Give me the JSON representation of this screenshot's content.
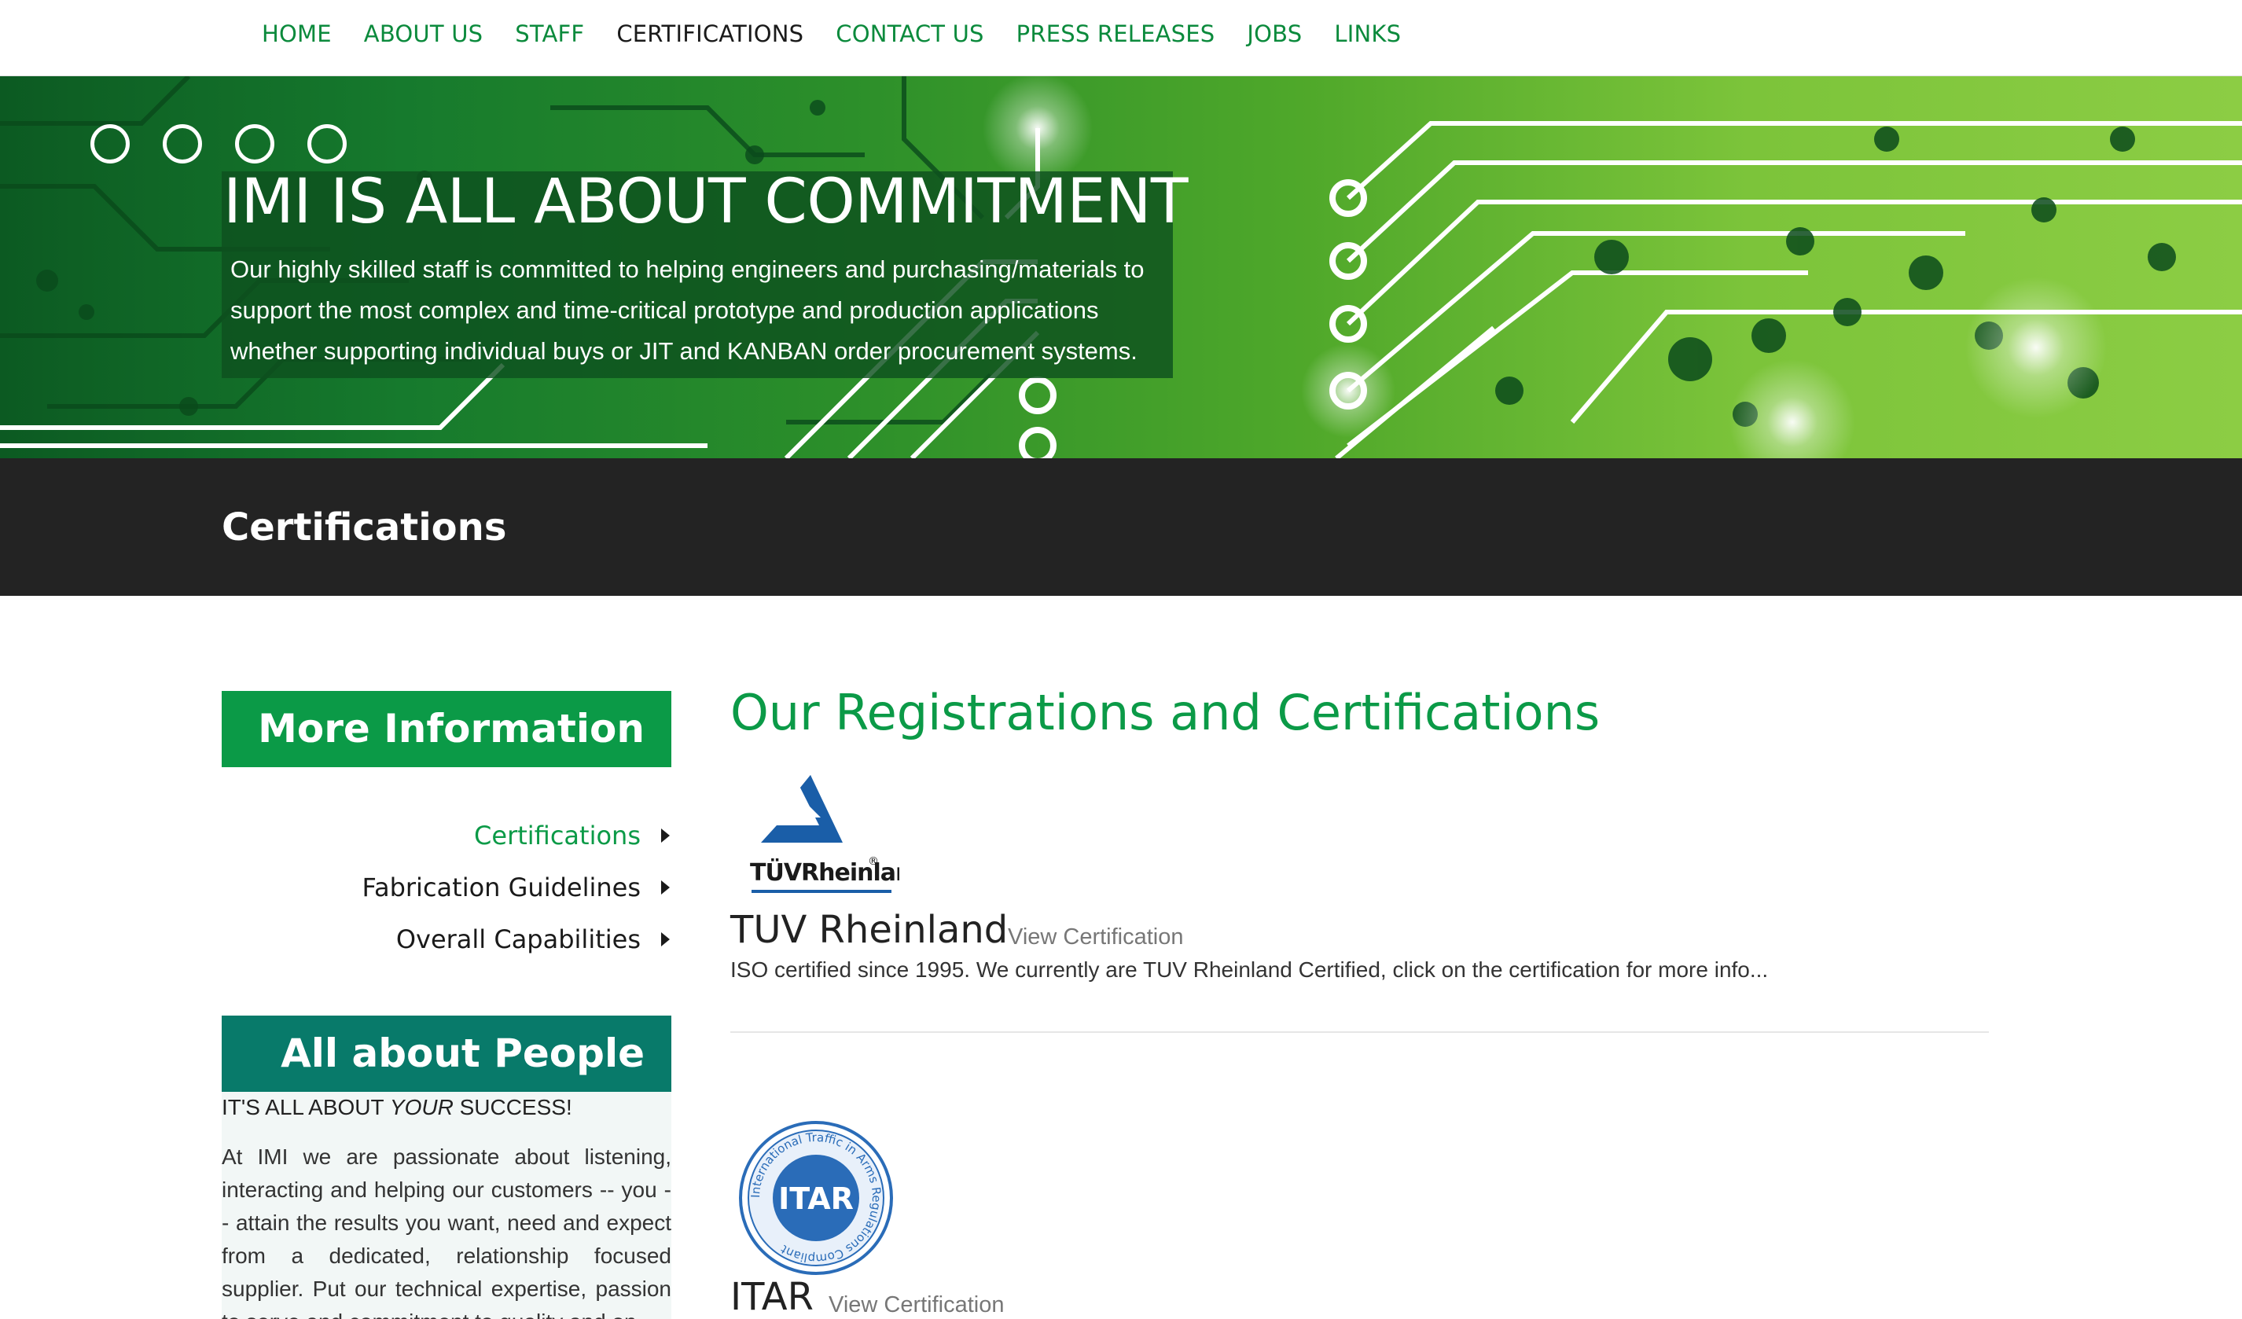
{
  "nav": {
    "items": [
      {
        "label": "HOME",
        "active": false
      },
      {
        "label": "ABOUT US",
        "active": false
      },
      {
        "label": "STAFF",
        "active": false
      },
      {
        "label": "CERTIFICATIONS",
        "active": true
      },
      {
        "label": "CONTACT US",
        "active": false
      },
      {
        "label": "PRESS RELEASES",
        "active": false
      },
      {
        "label": "JOBS",
        "active": false
      },
      {
        "label": "LINKS",
        "active": false
      }
    ]
  },
  "hero": {
    "title": "IMI IS ALL ABOUT COMMITMENT",
    "text": "Our highly skilled staff is committed to helping engineers and purchasing/materials to support the most complex and time-critical prototype and production applications whether supporting individual buys or JIT and KANBAN order procurement systems."
  },
  "page": {
    "title": "Certifications"
  },
  "sidebar": {
    "more_info_heading": "More Information",
    "links": [
      {
        "label": "Certifications",
        "active": true
      },
      {
        "label": "Fabrication Guidelines",
        "active": false
      },
      {
        "label": "Overall Capabilities",
        "active": false
      }
    ],
    "people_heading": "All about People",
    "people_tag_prefix": "IT'S ALL ABOUT ",
    "people_tag_emph": "YOUR",
    "people_tag_suffix": " SUCCESS!",
    "people_text": "At IMI we are passionate about listening, interacting and helping our customers -- you -- attain the results you want, need and expect from a dedicated, relationship focused supplier. Put our technical expertise, passion to serve and commitment to quality and on-"
  },
  "main": {
    "title": "Our Registrations and Certifications",
    "certs": [
      {
        "name": "TUV Rheinland",
        "link": "View Certification",
        "description": "ISO certified since 1995. We currently are TUV Rheinland Certified, click on the certification for more info...",
        "logo_text": "TÜVRheinland",
        "logo_mark": "®"
      },
      {
        "name": "ITAR",
        "link": "View Certification",
        "logo_text": "ITAR",
        "logo_ring_text": "International Traffic in Arms Regulations Compliant"
      }
    ]
  },
  "colors": {
    "brand_green": "#0b9a47",
    "nav_green": "#0b8a3c",
    "teal": "#087a6a",
    "dark_bar": "#232323",
    "tuv_blue": "#1a5ea8",
    "itar_blue": "#2a6cb8"
  }
}
